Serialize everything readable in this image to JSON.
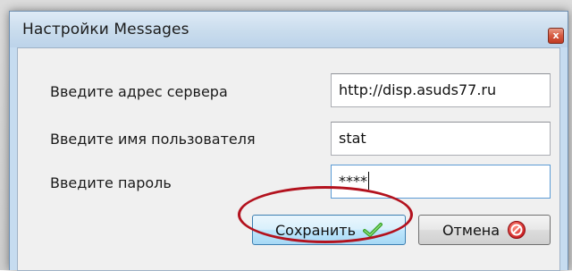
{
  "window": {
    "title": "Настройки Messages",
    "close_glyph": "x"
  },
  "form": {
    "server": {
      "label": "Введите адрес сервера",
      "value": "http://disp.asuds77.ru"
    },
    "username": {
      "label": "Введите имя пользователя",
      "value": "stat"
    },
    "password": {
      "label": "Введите пароль",
      "value": "****"
    }
  },
  "buttons": {
    "save_label": "Сохранить",
    "save_icon": "check-icon",
    "cancel_label": "Отмена",
    "cancel_icon": "cancel-icon"
  },
  "colors": {
    "highlight_ring": "#b3121e",
    "check_green": "#3aa32a",
    "cancel_red": "#d8201f"
  }
}
